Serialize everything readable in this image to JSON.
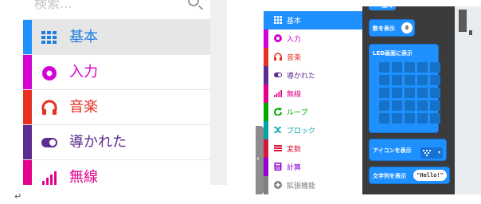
{
  "left_panel": {
    "search_placeholder": "検索...",
    "categories": [
      {
        "label": "基本",
        "color": "#1e90ff",
        "icon": "grid-icon",
        "selected": true
      },
      {
        "label": "入力",
        "color": "#d400d4",
        "icon": "radio-target-icon"
      },
      {
        "label": "音楽",
        "color": "#e63022",
        "icon": "headphones-icon"
      },
      {
        "label": "導かれた",
        "color": "#5c2d91",
        "icon": "toggle-icon"
      },
      {
        "label": "無線",
        "color": "#e3008c",
        "icon": "signal-bars-icon"
      }
    ]
  },
  "right_panel": {
    "categories": [
      {
        "label": "基本",
        "color": "#1e90ff",
        "icon": "grid-icon",
        "selected": true
      },
      {
        "label": "入力",
        "color": "#d400d4",
        "icon": "radio-target-icon"
      },
      {
        "label": "音楽",
        "color": "#e63022",
        "icon": "headphones-icon"
      },
      {
        "label": "導かれた",
        "color": "#5c2d91",
        "icon": "toggle-icon"
      },
      {
        "label": "無線",
        "color": "#e3008c",
        "icon": "signal-bars-icon"
      },
      {
        "label": "ループ",
        "color": "#00aa00",
        "icon": "loop-arrow-icon"
      },
      {
        "label": "ブロック",
        "color": "#00a4a6",
        "icon": "shuffle-icon"
      },
      {
        "label": "変数",
        "color": "#dc143c",
        "icon": "list-icon"
      },
      {
        "label": "計算",
        "color": "#9400d3",
        "icon": "calculator-icon"
      },
      {
        "label": "拡張機能",
        "color": "#7f7f7f",
        "icon": "plus-circle-icon"
      }
    ],
    "collapse_glyph": "‹",
    "flyout": {
      "header": "基本",
      "blocks": [
        {
          "label": "数を表示",
          "value": "0"
        },
        {
          "label": "LED画面に表示"
        },
        {
          "label": "アイコンを表示",
          "dropdown": "▾"
        },
        {
          "label": "文字列を表示",
          "value": "\"Hello!\""
        }
      ]
    }
  },
  "footer_glyph": "↵"
}
